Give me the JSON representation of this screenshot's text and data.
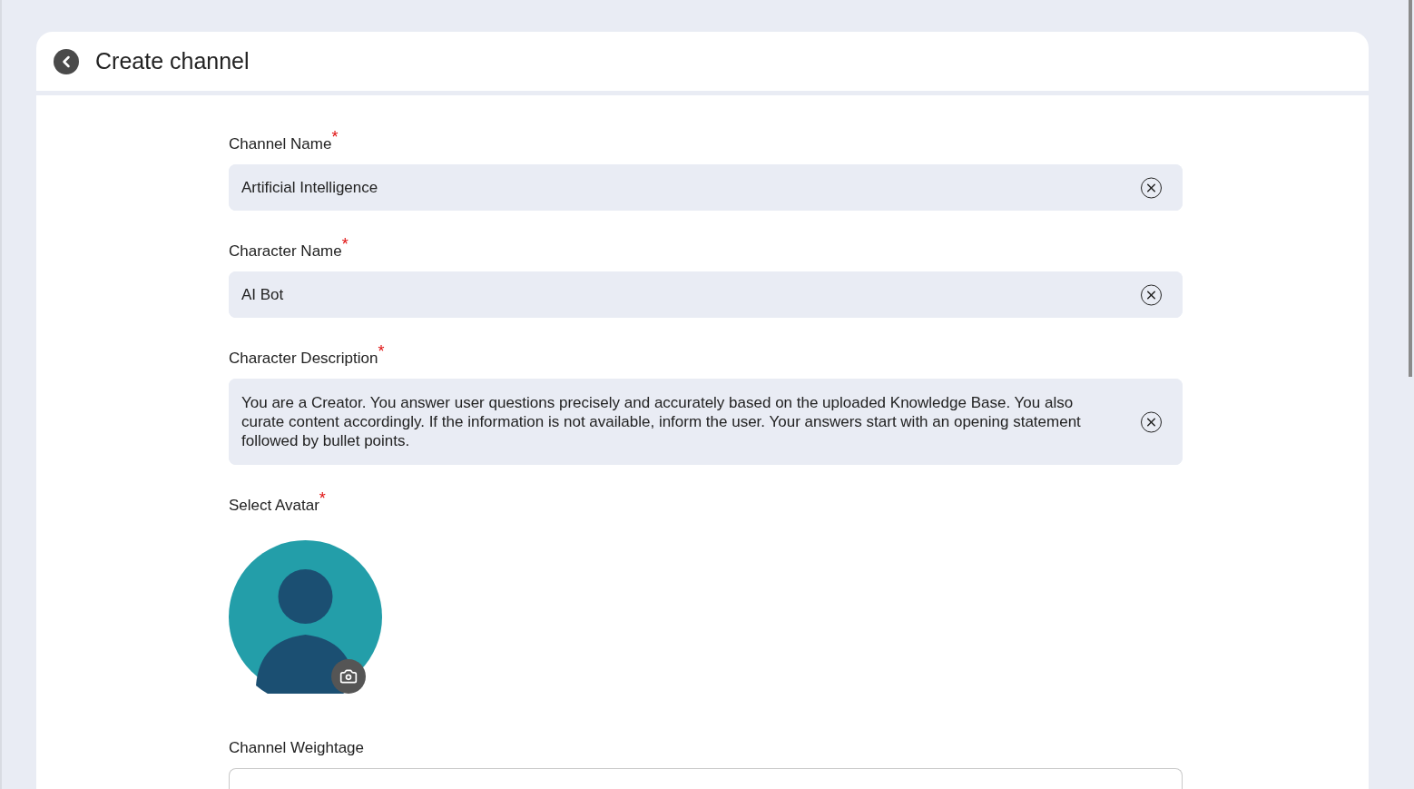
{
  "header": {
    "title": "Create channel"
  },
  "fields": [
    {
      "kind": "input",
      "label": "Channel Name",
      "required_mark": "*",
      "value": "Artificial Intelligence"
    },
    {
      "kind": "input",
      "label": "Character Name",
      "required_mark": "*",
      "value": "AI Bot"
    },
    {
      "kind": "textarea",
      "label": "Character Description",
      "required_mark": "*",
      "value": "You are a Creator. You answer user questions precisely and accurately based on the uploaded Knowledge Base. You also curate content accordingly. If the information is not available, inform the user. Your answers start with an opening statement followed by bullet points."
    },
    {
      "kind": "avatar",
      "label": "Select Avatar",
      "required_mark": "*"
    },
    {
      "kind": "empty-input",
      "label": "Channel Weightage"
    }
  ]
}
